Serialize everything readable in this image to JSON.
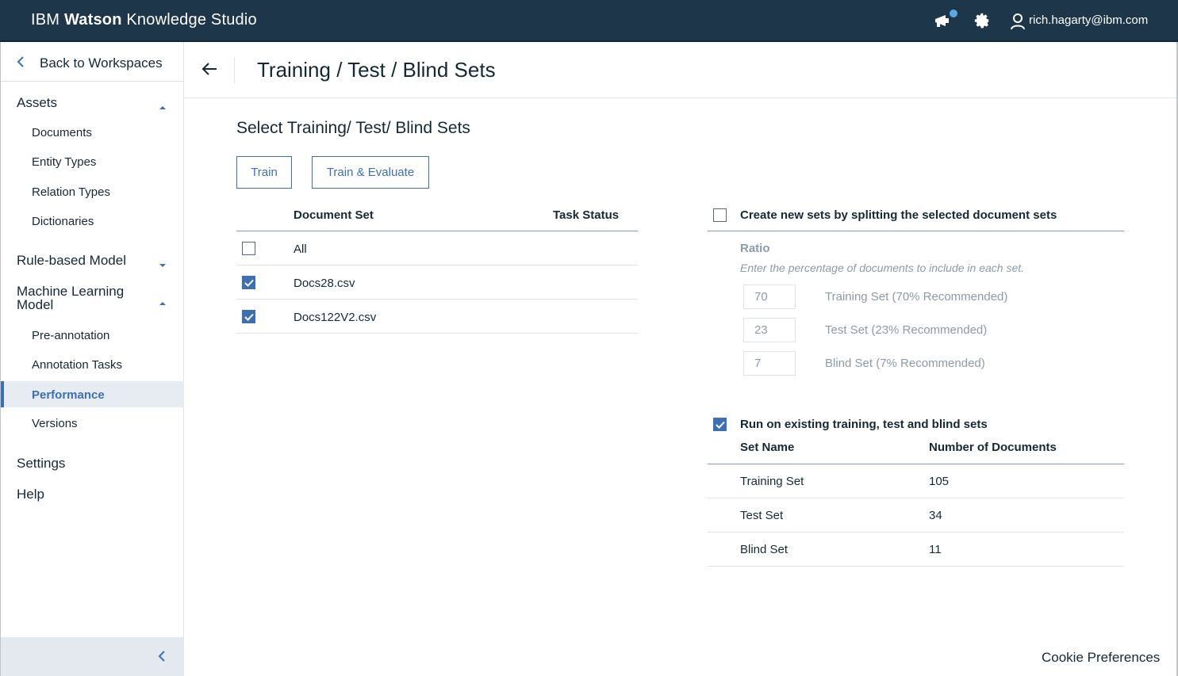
{
  "topbar": {
    "brand_prefix": "IBM",
    "brand_bold": "Watson",
    "brand_suffix": "Knowledge Studio",
    "user_email": "rich.hagarty@ibm.com",
    "icons": [
      "megaphone-icon",
      "gear-icon",
      "user-icon"
    ]
  },
  "sidebar": {
    "back_label": "Back to Workspaces",
    "assets": {
      "label": "Assets",
      "items": [
        "Documents",
        "Entity Types",
        "Relation Types",
        "Dictionaries"
      ]
    },
    "rule_based": {
      "label": "Rule-based Model"
    },
    "ml_model": {
      "label_line1": "Machine Learning",
      "label_line2": "Model",
      "items": [
        "Pre-annotation",
        "Annotation Tasks",
        "Performance",
        "Versions"
      ],
      "active": "Performance"
    },
    "settings_label": "Settings",
    "help_label": "Help"
  },
  "header": {
    "title": "Training / Test / Blind Sets"
  },
  "main": {
    "section_title": "Select Training/ Test/ Blind Sets",
    "train_label": "Train",
    "train_eval_label": "Train & Evaluate",
    "doc_table": {
      "col_document_set": "Document Set",
      "col_task_status": "Task Status",
      "rows": [
        {
          "name": "All",
          "checked": false
        },
        {
          "name": "Docs28.csv",
          "checked": true
        },
        {
          "name": "Docs122V2.csv",
          "checked": true
        }
      ]
    },
    "split": {
      "checked": false,
      "label": "Create new sets by splitting the selected document sets",
      "ratio_label": "Ratio",
      "ratio_help": "Enter the percentage of documents to include in each set.",
      "rows": [
        {
          "value": "70",
          "label": "Training Set  (70% Recommended)"
        },
        {
          "value": "23",
          "label": "Test Set  (23% Recommended)"
        },
        {
          "value": "7",
          "label": "Blind Set  (7% Recommended)"
        }
      ]
    },
    "existing": {
      "checked": true,
      "label": "Run on existing training, test and blind sets",
      "col_set_name": "Set Name",
      "col_num_docs": "Number of Documents",
      "rows": [
        {
          "name": "Training Set",
          "count": "105"
        },
        {
          "name": "Test Set",
          "count": "34"
        },
        {
          "name": "Blind Set",
          "count": "11"
        }
      ]
    }
  },
  "footer": {
    "cookie_label": "Cookie Preferences"
  },
  "colors": {
    "topbar_bg": "#1d3649",
    "accent": "#3d70b2",
    "muted_text": "#8c9ba5"
  }
}
